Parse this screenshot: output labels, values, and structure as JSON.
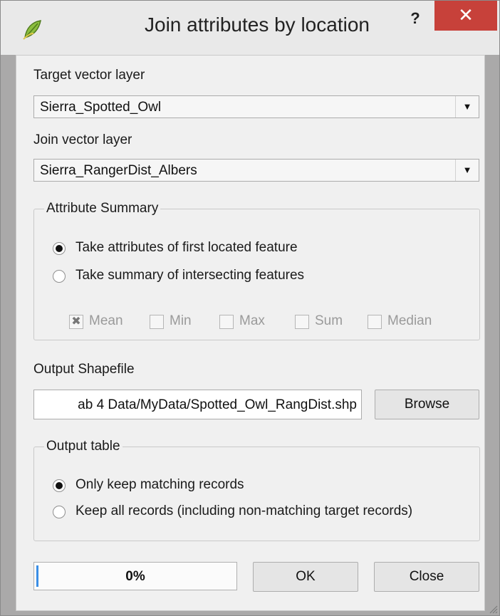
{
  "window": {
    "title": "Join attributes by location",
    "help_label": "?",
    "close_label": "✕"
  },
  "target_layer": {
    "label": "Target vector layer",
    "value": "Sierra_Spotted_Owl"
  },
  "join_layer": {
    "label": "Join vector layer",
    "value": "Sierra_RangerDist_Albers"
  },
  "attribute_summary": {
    "legend": "Attribute Summary",
    "options": [
      {
        "label": "Take attributes of first located feature",
        "selected": true
      },
      {
        "label": "Take summary of intersecting features",
        "selected": false
      }
    ],
    "stats": [
      {
        "label": "Mean",
        "checked": true,
        "enabled": false
      },
      {
        "label": "Min",
        "checked": false,
        "enabled": false
      },
      {
        "label": "Max",
        "checked": false,
        "enabled": false
      },
      {
        "label": "Sum",
        "checked": false,
        "enabled": false
      },
      {
        "label": "Median",
        "checked": false,
        "enabled": false
      }
    ]
  },
  "output": {
    "label": "Output Shapefile",
    "path": "ab 4 Data/MyData/Spotted_Owl_RangDist.shp",
    "browse_label": "Browse"
  },
  "output_table": {
    "legend": "Output table",
    "options": [
      {
        "label": "Only keep matching records",
        "selected": true
      },
      {
        "label": "Keep all records (including non-matching target records)",
        "selected": false
      }
    ]
  },
  "footer": {
    "progress_text": "0%",
    "progress_value": 0,
    "ok_label": "OK",
    "close_label": "Close"
  },
  "colors": {
    "close_button": "#c7413a",
    "progress_fill": "#3a8ee6"
  },
  "icons": {
    "app": "qgis-icon",
    "combo_arrow": "chevron-down-icon",
    "resize": "resize-grip-icon"
  }
}
